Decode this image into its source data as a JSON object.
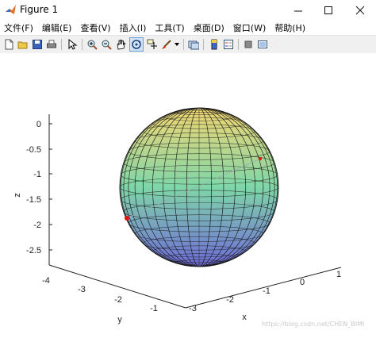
{
  "window": {
    "title": "Figure 1"
  },
  "menu": [
    "文件(F)",
    "编辑(E)",
    "查看(V)",
    "插入(I)",
    "工具(T)",
    "桌面(D)",
    "窗口(W)",
    "帮助(H)"
  ],
  "axes": {
    "xlabel": "x",
    "ylabel": "y",
    "zlabel": "z",
    "z_ticks": [
      "0",
      "-0.5",
      "-1",
      "-1.5",
      "-2",
      "-2.5"
    ],
    "y_ticks": [
      "-4",
      "-3",
      "-2",
      "-1"
    ],
    "x_ticks": [
      "-3",
      "-2",
      "-1",
      "0",
      "1"
    ]
  },
  "watermark": "https://blog.csdn.net/CHEN_BIMI",
  "colors": {
    "sphere_top": "#f2d772",
    "sphere_mid": "#7fd6a8",
    "sphere_bottom": "#6f6bd8",
    "point": "#e01010"
  }
}
